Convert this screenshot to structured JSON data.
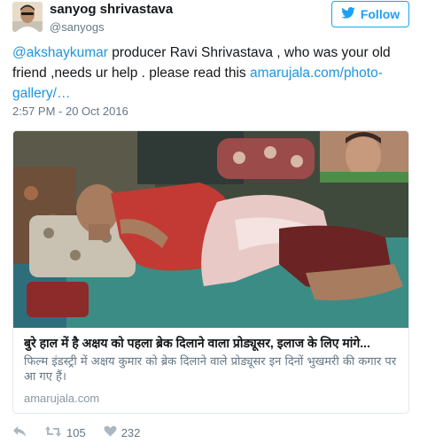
{
  "user": {
    "display_name": "sanyog shrivastava",
    "screen_name": "@sanyogs"
  },
  "follow_button": {
    "label": "Follow"
  },
  "tweet": {
    "mention": "@akshaykumar",
    "body": " producer Ravi Shrivastava , who was your old friend ,needs ur help . please read this ",
    "link": "amarujala.com/photo-gallery/…",
    "timestamp": "2:57 PM - 20 Oct 2016"
  },
  "card": {
    "title": "बुरे हाल में है अक्षय को पहला ब्रेक दिलाने वाला प्रोड्यूसर, इलाज के लिए मांगे...",
    "description": "फिल्म इंडस्ट्री में अक्षय कुमार को ब्रेक दिलाने वाले प्रोड्यूसर इन दिनों भुखमरी की कगार पर आ गए हैं।",
    "domain": "amarujala.com"
  },
  "actions": {
    "retweets": "105",
    "likes": "232"
  },
  "colors": {
    "link": "#1b95e0",
    "follow_border": "#1da1f2",
    "muted": "#657786"
  }
}
